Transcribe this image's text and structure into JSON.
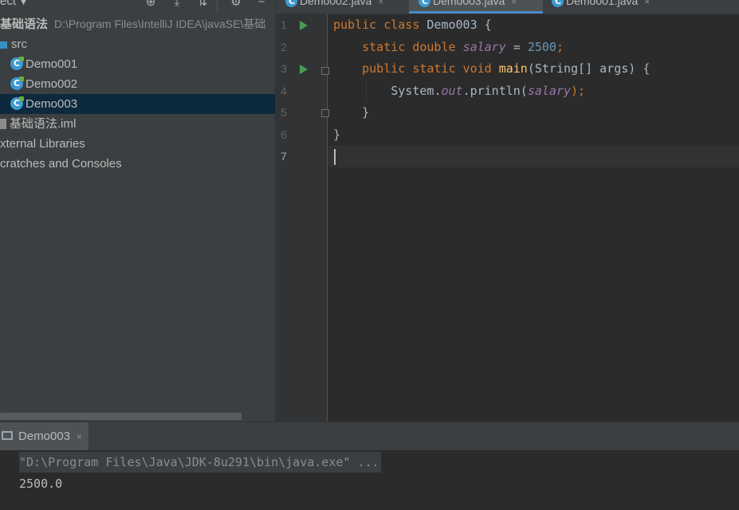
{
  "project": {
    "title": "ect",
    "root": {
      "name": "基础语法",
      "path": "D:\\Program Files\\IntelliJ IDEA\\javaSE\\基础"
    },
    "src": "src",
    "classes": [
      "Demo001",
      "Demo002",
      "Demo003"
    ],
    "selected": "Demo003",
    "iml": "基础语法.iml",
    "external_libraries": "xternal Libraries",
    "scratches": "cratches and Consoles"
  },
  "icons": {
    "target": "⊕",
    "collapse": "⤓",
    "expand": "⇅",
    "settings": "⚙",
    "hide": "−",
    "class_letter": "C"
  },
  "editor": {
    "tabs": [
      {
        "label": "Demo002.java",
        "active": false
      },
      {
        "label": "Demo003.java",
        "active": true
      },
      {
        "label": "Demo001.java",
        "active": false
      }
    ],
    "close_glyph": "×",
    "line_numbers": [
      "1",
      "2",
      "3",
      "4",
      "5",
      "6",
      "7"
    ],
    "current_line": 7,
    "code": [
      [
        {
          "t": "public class ",
          "c": "kw"
        },
        {
          "t": "Demo003 {",
          "c": ""
        }
      ],
      [
        {
          "t": "    ",
          "c": ""
        },
        {
          "t": "static double ",
          "c": "kw"
        },
        {
          "t": "salary",
          "c": "field"
        },
        {
          "t": " = ",
          "c": ""
        },
        {
          "t": "2500",
          "c": "num"
        },
        {
          "t": ";",
          "c": "kw"
        }
      ],
      [
        {
          "t": "    ",
          "c": ""
        },
        {
          "t": "public static void ",
          "c": "kw"
        },
        {
          "t": "main",
          "c": "fn"
        },
        {
          "t": "(String[] args) {",
          "c": ""
        }
      ],
      [
        {
          "t": "        System.",
          "c": ""
        },
        {
          "t": "out",
          "c": "field"
        },
        {
          "t": ".println(",
          "c": ""
        },
        {
          "t": "salary",
          "c": "field"
        },
        {
          "t": ");",
          "c": "kw"
        }
      ],
      [
        {
          "t": "    }",
          "c": ""
        }
      ],
      [
        {
          "t": "}",
          "c": ""
        }
      ],
      []
    ]
  },
  "run": {
    "tab_label": "Demo003",
    "close_glyph": "×",
    "command": "\"D:\\Program Files\\Java\\JDK-8u291\\bin\\java.exe\" ...",
    "output": "2500.0"
  }
}
